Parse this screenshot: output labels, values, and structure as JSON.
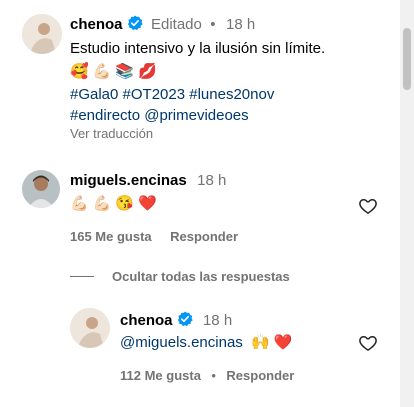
{
  "post_comment": {
    "username": "chenoa",
    "edited_label": "Editado",
    "dot": "•",
    "time": "18 h",
    "caption": "Estudio intensivo y la ilusión sin límite.",
    "emojis": [
      "🥰",
      "💪🏻",
      "📚",
      "💋"
    ],
    "hashtags_line1": "#Gala0 #OT2023 #lunes20nov",
    "hashtags_line2": "#endirecto @primevideoes",
    "translate_label": "Ver traducción"
  },
  "reply_comment": {
    "username": "miguels.encinas",
    "time": "18 h",
    "emojis": [
      "💪🏻",
      "💪🏻",
      "😘",
      "❤️"
    ],
    "likes": "165 Me gusta",
    "reply_label": "Responder"
  },
  "hide_replies_label": "Ocultar todas las respuestas",
  "nested_reply": {
    "username": "chenoa",
    "time": "18 h",
    "mention": "@miguels.encinas",
    "emojis": [
      "🙌",
      "❤️"
    ],
    "likes": "112 Me gusta",
    "dot": "•",
    "reply_label": "Responder"
  },
  "colors": {
    "verified_blue": "#0095f6",
    "muted_text": "#737373",
    "link_blue": "#00376b"
  },
  "icons": [
    "verified-badge-icon",
    "heart-outline-icon"
  ]
}
